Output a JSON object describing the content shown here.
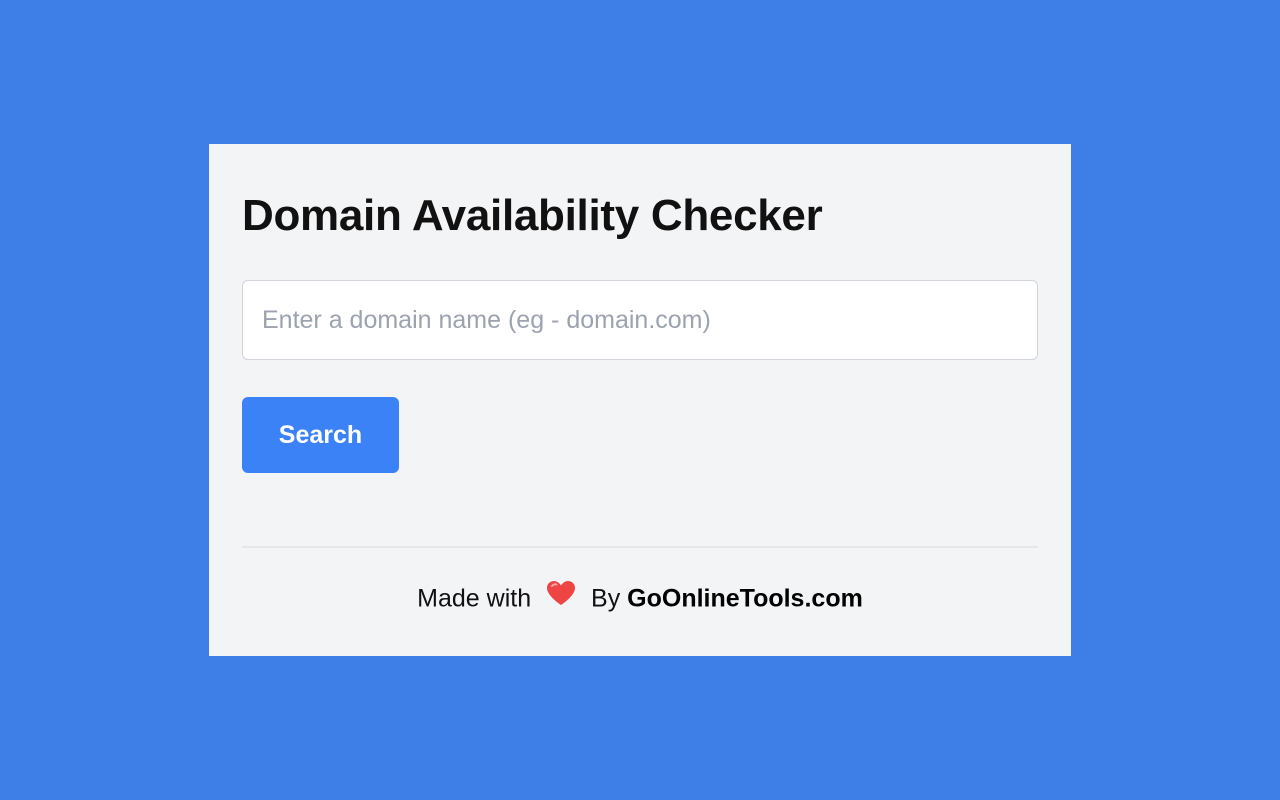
{
  "card": {
    "title": "Domain Availability Checker",
    "input": {
      "value": "",
      "placeholder": "Enter a domain name (eg - domain.com)"
    },
    "search_label": "Search"
  },
  "footer": {
    "prefix": "Made with",
    "icon": "heart-icon",
    "by": "By",
    "brand": "GoOnlineTools.com"
  },
  "colors": {
    "background": "#3d7fe6",
    "card": "#f3f4f6",
    "button": "#3b82f6",
    "heart": "#ef4444"
  }
}
